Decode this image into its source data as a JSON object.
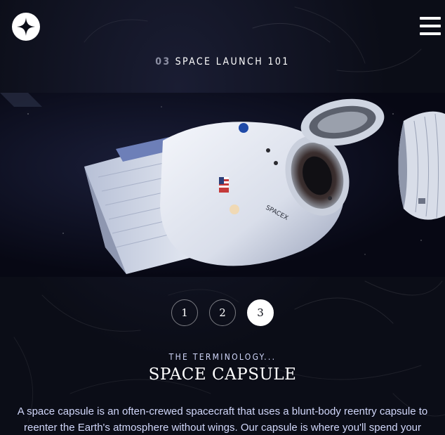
{
  "header": {
    "logo_icon": "star-logo-icon",
    "menu_icon": "hamburger-menu-icon"
  },
  "page_heading": {
    "number": "03",
    "label": "SPACE LAUNCH 101"
  },
  "hero_image": {
    "subject": "spacecraft"
  },
  "pager": {
    "items": [
      "1",
      "2",
      "3"
    ],
    "active_index": 2
  },
  "terminology": {
    "eyebrow": "THE TERMINOLOGY...",
    "title": "SPACE CAPSULE",
    "description": "A space capsule is an often-crewed spacecraft that uses a blunt-body reentry capsule to reenter the Earth's atmosphere without wings. Our capsule is where you'll spend your time"
  },
  "colors": {
    "background": "#0b0d17",
    "text_muted": "#d0d6f9",
    "accent_white": "#ffffff"
  }
}
